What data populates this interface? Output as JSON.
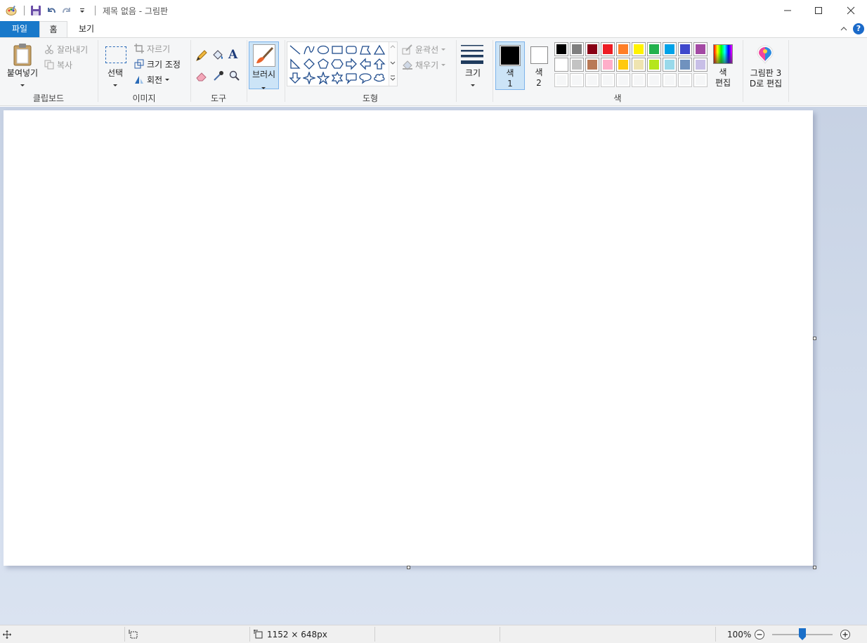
{
  "window": {
    "title": "제목 없음 - 그림판"
  },
  "tabs": {
    "file": "파일",
    "home": "홈",
    "view": "보기"
  },
  "clipboard": {
    "paste": "붙여넣기",
    "cut": "잘라내기",
    "copy": "복사",
    "group_label": "클립보드"
  },
  "image": {
    "select": "선택",
    "crop": "자르기",
    "resize": "크기 조정",
    "rotate": "회전",
    "group_label": "이미지"
  },
  "tools": {
    "group_label": "도구"
  },
  "brushes": {
    "label": "브러시"
  },
  "shapes": {
    "outline": "윤곽선",
    "fill": "채우기",
    "group_label": "도형"
  },
  "size": {
    "label": "크기"
  },
  "colors": {
    "color1_label": "색",
    "color1_num": "1",
    "color2_label": "색",
    "color2_num": "2",
    "edit_label": "색",
    "edit_label2": "편집",
    "group_label": "색",
    "color1": "#000000",
    "color2": "#ffffff",
    "palette_row1": [
      "#000000",
      "#7f7f7f",
      "#880015",
      "#ed1c24",
      "#ff7f27",
      "#fff200",
      "#22b14c",
      "#00a2e8",
      "#3f48cc",
      "#a349a4"
    ],
    "palette_row2": [
      "#ffffff",
      "#c3c3c3",
      "#b97a57",
      "#ffaec9",
      "#ffc90e",
      "#efe4b0",
      "#b5e61d",
      "#99d9ea",
      "#7092be",
      "#c8bfe7"
    ]
  },
  "paint3d": {
    "label1": "그림판 3",
    "label2": "D로 편집"
  },
  "status": {
    "canvas_size": "1152 × 648px",
    "zoom": "100%",
    "zoom_fraction": 0.5
  }
}
